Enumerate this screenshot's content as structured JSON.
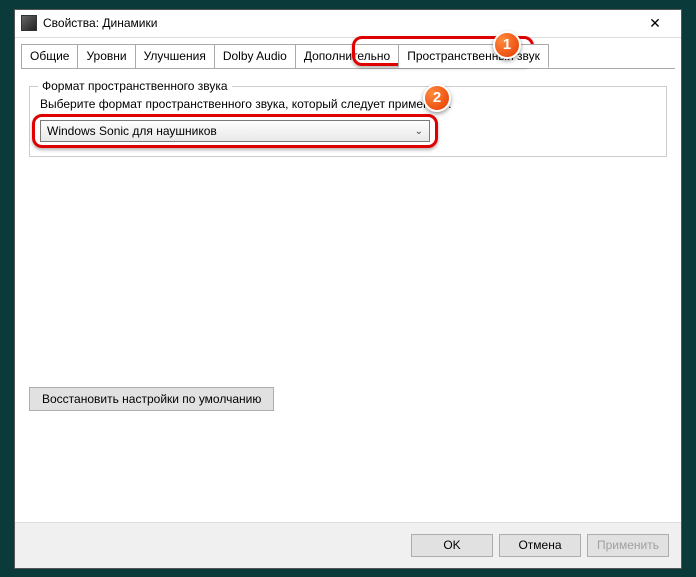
{
  "titlebar": {
    "title": "Свойства: Динамики"
  },
  "tabs": {
    "items": [
      {
        "label": "Общие"
      },
      {
        "label": "Уровни"
      },
      {
        "label": "Улучшения"
      },
      {
        "label": "Dolby Audio"
      },
      {
        "label": "Дополнительно"
      },
      {
        "label": "Пространственный звук"
      }
    ]
  },
  "fieldset": {
    "legend": "Формат пространственного звука",
    "description": "Выберите формат пространственного звука, который следует применить.",
    "select_value": "Windows Sonic для наушников"
  },
  "restore": {
    "label": "Восстановить настройки по умолчанию"
  },
  "footer": {
    "ok": "OK",
    "cancel": "Отмена",
    "apply": "Применить"
  },
  "badges": {
    "b1": "1",
    "b2": "2"
  }
}
